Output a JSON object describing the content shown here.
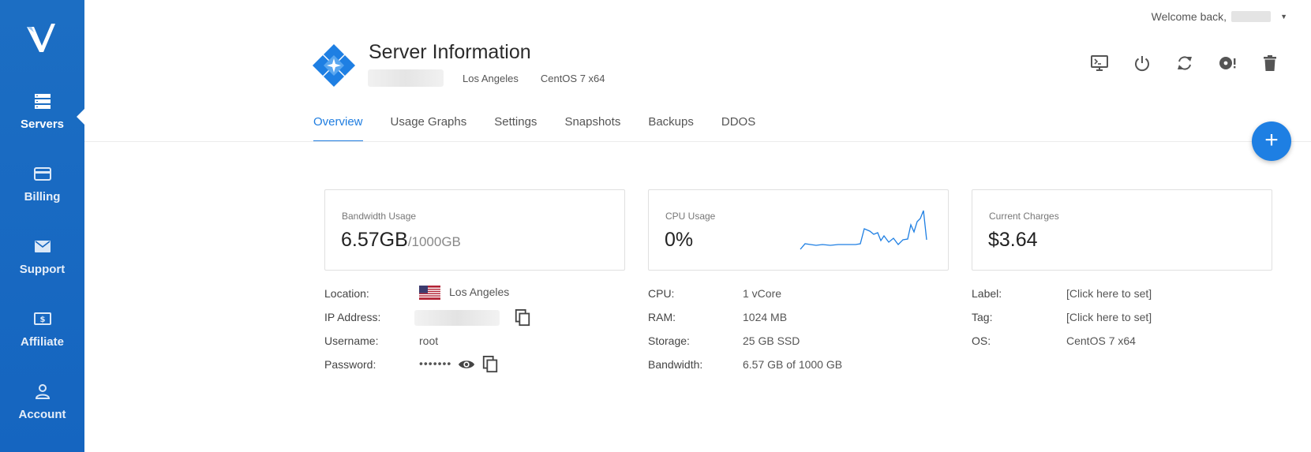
{
  "sidebar": {
    "logo_icon": "vultr-logo",
    "items": [
      {
        "label": "Servers",
        "icon": "server-stack-icon",
        "active": true
      },
      {
        "label": "Billing",
        "icon": "credit-card-icon",
        "active": false
      },
      {
        "label": "Support",
        "icon": "envelope-icon",
        "active": false
      },
      {
        "label": "Affiliate",
        "icon": "dollar-bill-icon",
        "active": false
      },
      {
        "label": "Account",
        "icon": "user-icon",
        "active": false
      }
    ]
  },
  "header": {
    "welcome": "Welcome back,",
    "title": "Server Information",
    "location": "Los Angeles",
    "os": "CentOS 7 x64",
    "actions": [
      "console-icon",
      "power-icon",
      "restart-icon",
      "reinstall-icon",
      "trash-icon"
    ]
  },
  "tabs": [
    {
      "label": "Overview",
      "active": true
    },
    {
      "label": "Usage Graphs",
      "active": false
    },
    {
      "label": "Settings",
      "active": false
    },
    {
      "label": "Snapshots",
      "active": false
    },
    {
      "label": "Backups",
      "active": false
    },
    {
      "label": "DDOS",
      "active": false
    }
  ],
  "fab": {
    "label": "+"
  },
  "cards": {
    "bandwidth": {
      "label": "Bandwidth Usage",
      "value": "6.57GB",
      "total": "/1000GB"
    },
    "cpu": {
      "label": "CPU Usage",
      "value": "0%"
    },
    "charges": {
      "label": "Current Charges",
      "value": "$3.64"
    }
  },
  "info_left": {
    "location_label": "Location:",
    "location_value": "Los Angeles",
    "ip_label": "IP Address:",
    "username_label": "Username:",
    "username_value": "root",
    "password_label": "Password:",
    "password_value": "•••••••"
  },
  "info_mid": {
    "cpu_label": "CPU:",
    "cpu_value": "1 vCore",
    "ram_label": "RAM:",
    "ram_value": "1024 MB",
    "storage_label": "Storage:",
    "storage_value": "25 GB SSD",
    "bandwidth_label": "Bandwidth:",
    "bandwidth_value": "6.57 GB of 1000 GB"
  },
  "info_right": {
    "label_label": "Label:",
    "label_value": "[Click here to set]",
    "tag_label": "Tag:",
    "tag_value": "[Click here to set]",
    "os_label": "OS:",
    "os_value": "CentOS 7 x64"
  },
  "colors": {
    "sidebar": "#1565c0",
    "accent": "#1f7de0",
    "text": "#333333"
  }
}
